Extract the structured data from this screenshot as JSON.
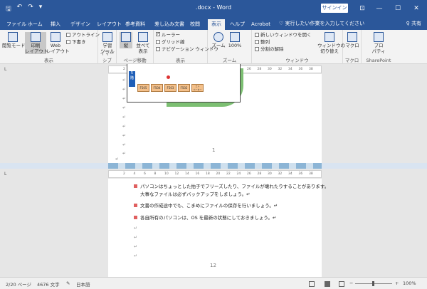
{
  "window": {
    "title": ".docx - Word",
    "signin_label": "サインイン",
    "minimize": "—",
    "restore": "☐",
    "close": "✕",
    "ribbon_display": "⊡",
    "save_icon": "🖫",
    "undo_icon": "↶",
    "redo_icon": "↷",
    "customize_icon": "▾"
  },
  "tabs": [
    "ファイル",
    "ホーム",
    "挿入",
    "デザイン",
    "レイアウト",
    "参考資料",
    "差し込み文書",
    "校閲",
    "表示",
    "ヘルプ",
    "Acrobat"
  ],
  "active_tab": "表示",
  "tellme": "♡ 実行したい作業を入力してください",
  "share": "♀ 共有",
  "ribbon": {
    "views": {
      "label": "表示",
      "read_mode": "閲覧モード",
      "print_layout": "印刷\nレイアウト",
      "web_layout": "Web\nレイアウト",
      "outline": "アウトライン",
      "draft": "下書き"
    },
    "immersive": {
      "label": "イマーシブ",
      "learning_tools": "学習\nツール"
    },
    "page_movement": {
      "label": "ページ移動",
      "vertical": "縦",
      "side_by_side": "並べて\n表示"
    },
    "show": {
      "label": "表示",
      "ruler": "ルーラー",
      "gridlines": "グリッド線",
      "navigation": "ナビゲーション ウィンドウ"
    },
    "zoom": {
      "label": "ズーム",
      "zoom": "ズーム",
      "percent": "100%"
    },
    "window": {
      "label": "ウィンドウ",
      "new_window": "新しいウィンドウを開く",
      "arrange": "整列",
      "split_remove": "分割の解除",
      "switch": "ウィンドウの\n切り替え"
    },
    "macro": {
      "label": "マクロ",
      "macro": "マクロ"
    },
    "sharepoint": {
      "label": "SharePoint",
      "properties": "プロ\nパティ"
    }
  },
  "ruler_ticks": [
    "2",
    "4",
    "6",
    "8",
    "10",
    "12",
    "14",
    "16",
    "18",
    "20",
    "22",
    "24",
    "26",
    "28",
    "30",
    "32",
    "34",
    "36",
    "38"
  ],
  "ruler_corner": "L",
  "page_top": {
    "floor_label": "5\n階",
    "rooms": [
      "F505",
      "F504",
      "F503",
      "F502",
      "エレ\nベーター"
    ],
    "page_number": "1",
    "para_marks": [
      "↵",
      "↵",
      "↵",
      "↵",
      "↵",
      "↵",
      "↵",
      "↵",
      "↵",
      "↵"
    ]
  },
  "page_bottom": {
    "lines": [
      "パソコンはちょっとした拍子でフリーズしたり、ファイルが壊れたりすることがあります。",
      "大事なファイルは必ずバックアップをしましょう。↵",
      "文書の作成途中でも、こまめにファイルの保存を行いましょう。↵",
      "各自所有のパソコンは、OS を最新の状態にしておきましょう。↵"
    ],
    "para_marks": [
      "↵",
      "↵",
      "↵",
      "↵"
    ],
    "page_number": "12"
  },
  "status": {
    "page": "2/20 ページ",
    "words": "4676 文字",
    "proof_icon": "✎",
    "language": "日本語",
    "zoom_minus": "−",
    "zoom_plus": "+",
    "zoom_percent": "100%"
  }
}
